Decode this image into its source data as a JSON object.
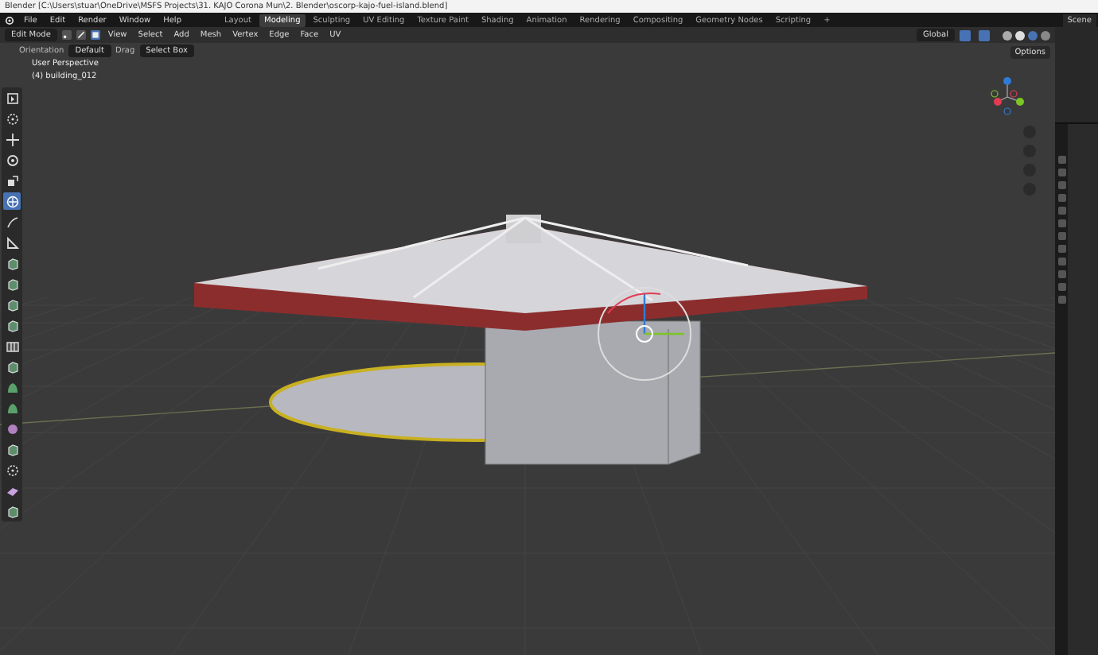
{
  "window": {
    "title": "Blender [C:\\Users\\stuar\\OneDrive\\MSFS Projects\\31. KAJO Corona Mun\\2. Blender\\oscorp-kajo-fuel-island.blend]"
  },
  "menu": [
    "File",
    "Edit",
    "Render",
    "Window",
    "Help"
  ],
  "workspaces": [
    {
      "label": "Layout",
      "selected": false
    },
    {
      "label": "Modeling",
      "selected": true
    },
    {
      "label": "Sculpting",
      "selected": false
    },
    {
      "label": "UV Editing",
      "selected": false
    },
    {
      "label": "Texture Paint",
      "selected": false
    },
    {
      "label": "Shading",
      "selected": false
    },
    {
      "label": "Animation",
      "selected": false
    },
    {
      "label": "Rendering",
      "selected": false
    },
    {
      "label": "Compositing",
      "selected": false
    },
    {
      "label": "Geometry Nodes",
      "selected": false
    },
    {
      "label": "Scripting",
      "selected": false
    }
  ],
  "add_workspace": "+",
  "scene": "Scene",
  "header": {
    "mode": "Edit Mode",
    "select_modes": [
      {
        "kind": "vertex",
        "selected": false
      },
      {
        "kind": "edge",
        "selected": false
      },
      {
        "kind": "face",
        "selected": true
      }
    ],
    "menus": [
      "View",
      "Select",
      "Add",
      "Mesh",
      "Vertex",
      "Edge",
      "Face",
      "UV"
    ],
    "transform_orientation": "Global",
    "options": "Options"
  },
  "tool_settings": {
    "orientation_label": "Orientation",
    "orientation": "Default",
    "drag_label": "Drag",
    "drag": "Select Box"
  },
  "viewport": {
    "view_name": "User Perspective",
    "object": "(4) building_012"
  },
  "toolbar": [
    {
      "kind": "select",
      "selected": false
    },
    {
      "kind": "cursor",
      "selected": false
    },
    {
      "kind": "move",
      "selected": false
    },
    {
      "kind": "rotate",
      "selected": false
    },
    {
      "kind": "scale",
      "selected": false
    },
    {
      "kind": "transform",
      "selected": true
    },
    {
      "kind": "annotate",
      "selected": false
    },
    {
      "kind": "measure",
      "selected": false
    },
    {
      "kind": "cube",
      "selected": false
    },
    {
      "kind": "cube",
      "selected": false
    },
    {
      "kind": "cube",
      "selected": false
    },
    {
      "kind": "cube",
      "selected": false
    },
    {
      "kind": "loop",
      "selected": false
    },
    {
      "kind": "cube",
      "selected": false
    },
    {
      "kind": "blob",
      "selected": false
    },
    {
      "kind": "blob",
      "selected": false
    },
    {
      "kind": "sphere",
      "selected": false
    },
    {
      "kind": "cube",
      "selected": false
    },
    {
      "kind": "cursor",
      "selected": false
    },
    {
      "kind": "slab",
      "selected": false
    },
    {
      "kind": "cube",
      "selected": false
    }
  ]
}
